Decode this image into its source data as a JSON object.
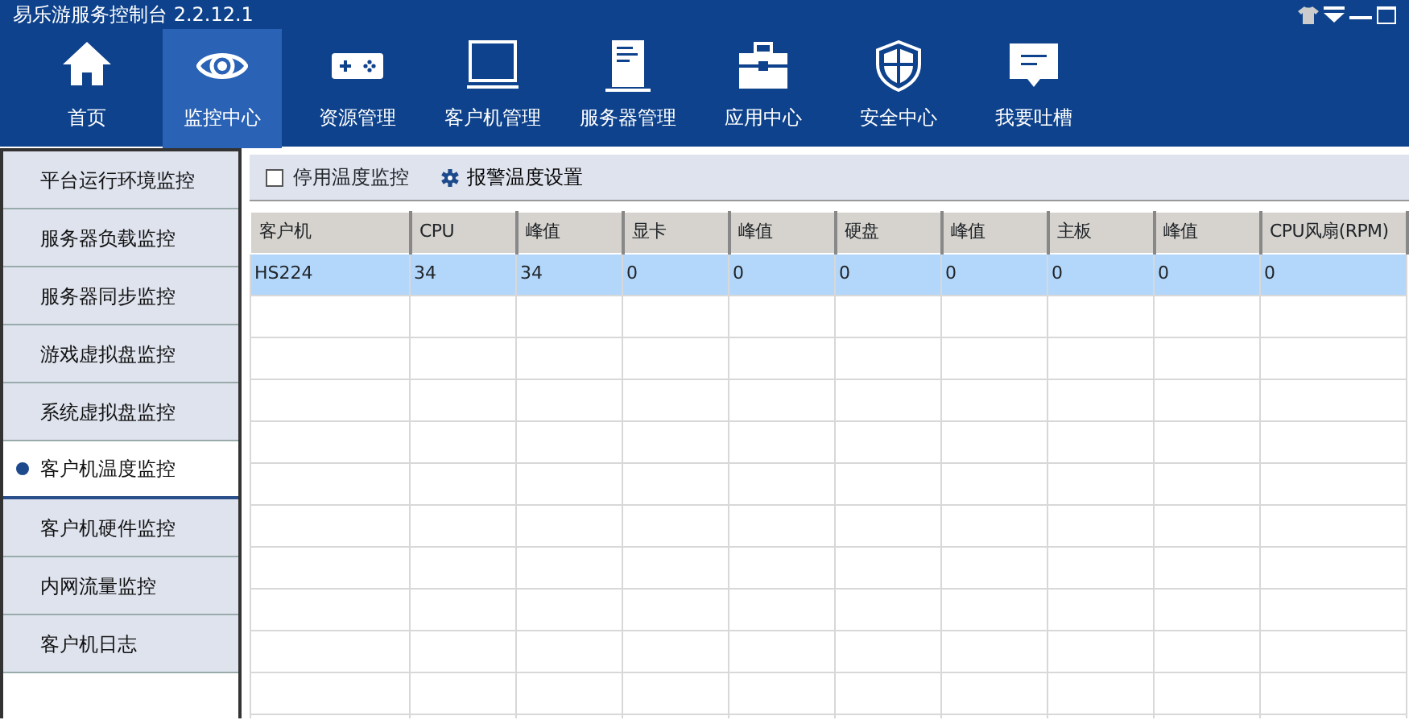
{
  "window": {
    "title": "易乐游服务控制台 2.2.12.1"
  },
  "nav": [
    {
      "label": "首页",
      "kind": "home",
      "selected": false
    },
    {
      "label": "监控中心",
      "kind": "eye",
      "selected": true
    },
    {
      "label": "资源管理",
      "kind": "gamepad",
      "selected": false
    },
    {
      "label": "客户机管理",
      "kind": "monitor",
      "selected": false
    },
    {
      "label": "服务器管理",
      "kind": "server",
      "selected": false
    },
    {
      "label": "应用中心",
      "kind": "toolbox",
      "selected": false
    },
    {
      "label": "安全中心",
      "kind": "shield",
      "selected": false
    },
    {
      "label": "我要吐槽",
      "kind": "chat",
      "selected": false
    }
  ],
  "sidebar": {
    "items": [
      {
        "label": "平台运行环境监控",
        "selected": false
      },
      {
        "label": "服务器负载监控",
        "selected": false
      },
      {
        "label": "服务器同步监控",
        "selected": false
      },
      {
        "label": "游戏虚拟盘监控",
        "selected": false
      },
      {
        "label": "系统虚拟盘监控",
        "selected": false
      },
      {
        "label": "客户机温度监控",
        "selected": true
      },
      {
        "label": "客户机硬件监控",
        "selected": false
      },
      {
        "label": "内网流量监控",
        "selected": false
      },
      {
        "label": "客户机日志",
        "selected": false
      }
    ]
  },
  "toolbar": {
    "disable_checkbox": {
      "label": "停用温度监控",
      "checked": false
    },
    "alarm_settings": {
      "label": "报警温度设置"
    }
  },
  "table": {
    "columns": [
      "客户机",
      "CPU",
      "峰值",
      "显卡",
      "峰值",
      "硬盘",
      "峰值",
      "主板",
      "峰值",
      "CPU风扇(RPM)"
    ],
    "rows": [
      {
        "cells": [
          "HS224",
          "34",
          "34",
          "0",
          "0",
          "0",
          "0",
          "0",
          "0",
          "0"
        ],
        "selected": true
      }
    ]
  }
}
